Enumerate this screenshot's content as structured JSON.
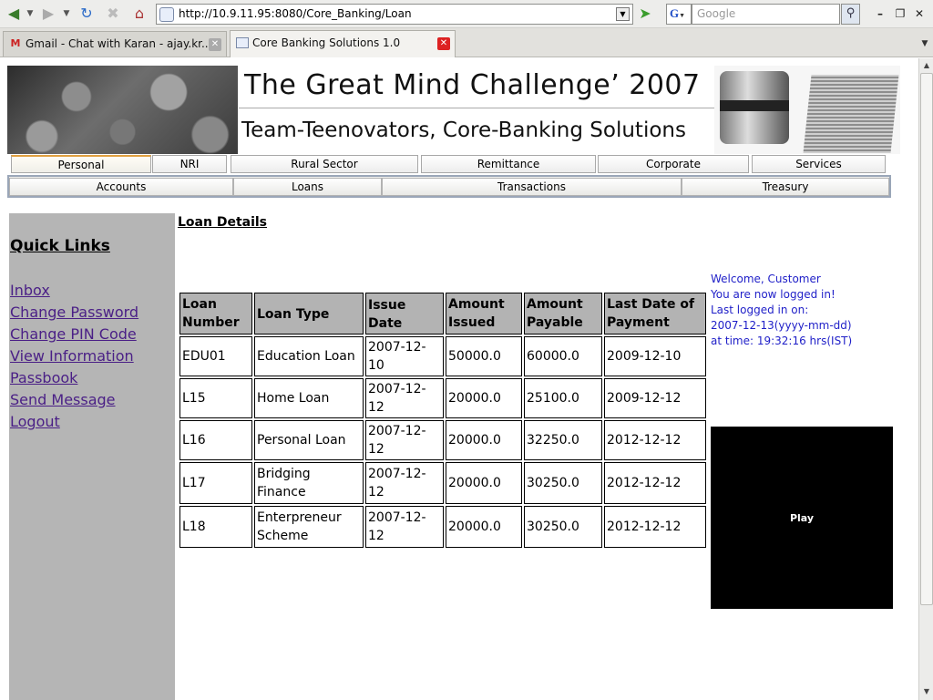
{
  "browser": {
    "url": "http://10.9.11.95:8080/Core_Banking/Loan",
    "search_placeholder": "Google",
    "search_engine_letter": "G",
    "tabs": [
      {
        "label": "Gmail - Chat with Karan - ajay.kr..."
      },
      {
        "label": "Core Banking Solutions 1.0"
      }
    ]
  },
  "banner": {
    "title": "The Great Mind Challenge’ 2007",
    "subtitle": "Team-Teenovators, Core-Banking Solutions"
  },
  "menu_primary": [
    "Personal",
    "NRI",
    "Rural Sector",
    "Remittance",
    "Corporate",
    "Services"
  ],
  "menu_secondary": [
    "Accounts",
    "Loans",
    "Transactions",
    "Treasury"
  ],
  "sidebar": {
    "title": "Quick Links",
    "links": [
      "Inbox",
      "Change Password",
      "Change PIN Code",
      "View Information",
      "Passbook",
      "Send Message",
      "Logout"
    ]
  },
  "main": {
    "title": "Loan Details",
    "table": {
      "headers": [
        [
          "Loan",
          "Number"
        ],
        [
          "Loan Type"
        ],
        [
          "Issue Date"
        ],
        [
          "Amount",
          "Issued"
        ],
        [
          "Amount",
          "Payable"
        ],
        [
          "Last Date of",
          "Payment"
        ]
      ],
      "rows": [
        [
          [
            "EDU01"
          ],
          [
            "Education Loan"
          ],
          [
            "2007-12-10"
          ],
          [
            "50000.0"
          ],
          [
            "60000.0"
          ],
          [
            "2009-12-10"
          ]
        ],
        [
          [
            "L15"
          ],
          [
            "Home Loan"
          ],
          [
            "2007-12-12"
          ],
          [
            "20000.0"
          ],
          [
            "25100.0"
          ],
          [
            "2009-12-12"
          ]
        ],
        [
          [
            "L16"
          ],
          [
            "Personal Loan"
          ],
          [
            "2007-12-12"
          ],
          [
            "20000.0"
          ],
          [
            "32250.0"
          ],
          [
            "2012-12-12"
          ]
        ],
        [
          [
            "L17"
          ],
          [
            "Bridging",
            "Finance"
          ],
          [
            "2007-12-12"
          ],
          [
            "20000.0"
          ],
          [
            "30250.0"
          ],
          [
            "2012-12-12"
          ]
        ],
        [
          [
            "L18"
          ],
          [
            "Enterpreneur",
            "Scheme"
          ],
          [
            "2007-12-12"
          ],
          [
            "20000.0"
          ],
          [
            "30250.0"
          ],
          [
            "2012-12-12"
          ]
        ]
      ]
    }
  },
  "welcome": {
    "lines": [
      "Welcome, Customer",
      "You are now logged in!",
      "Last logged in on:",
      "2007-12-13(yyyy-mm-dd)",
      "at time: 19:32:16 hrs(IST)"
    ]
  },
  "player": {
    "label": "Play"
  }
}
